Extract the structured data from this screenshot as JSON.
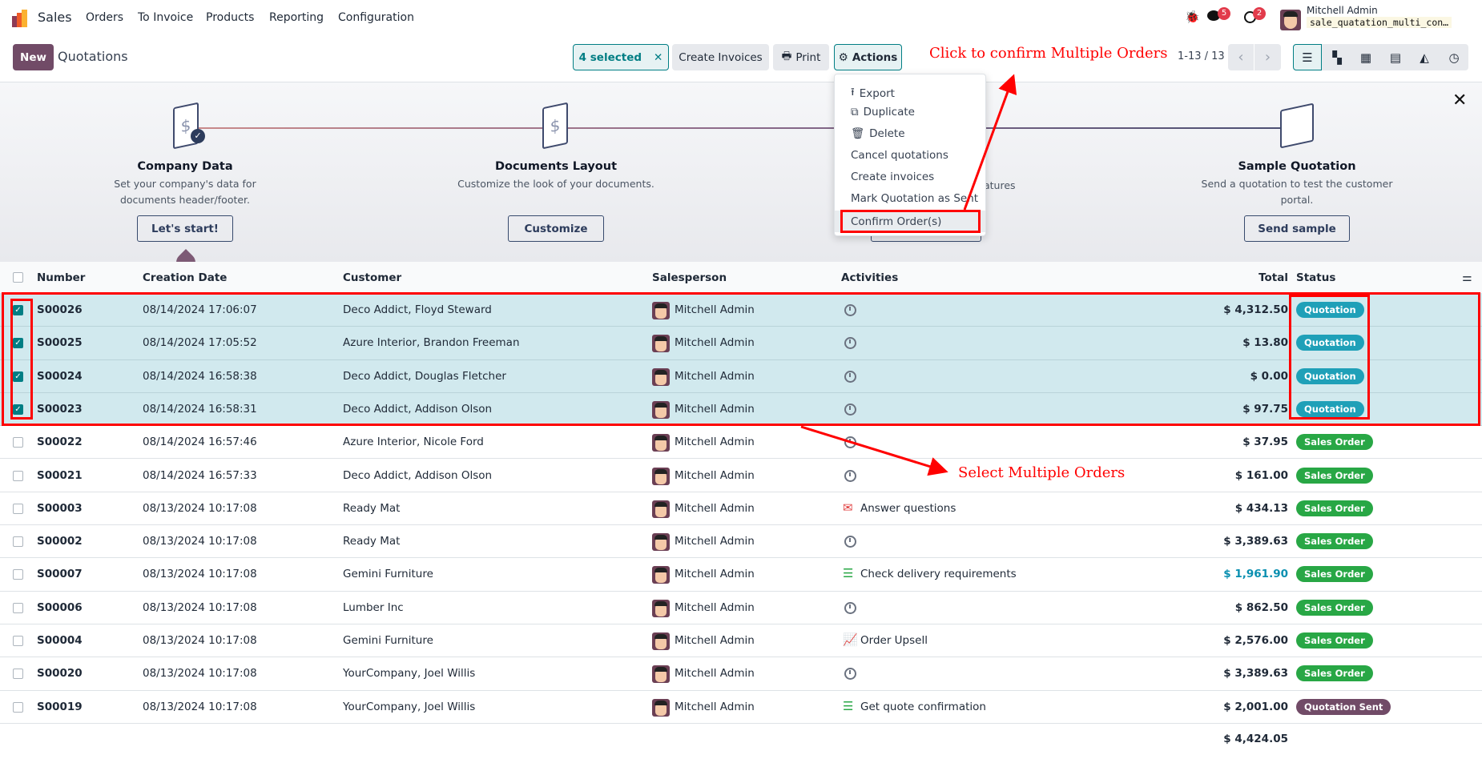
{
  "nav": {
    "app": "Sales",
    "menu": [
      "Orders",
      "To Invoice",
      "Products",
      "Reporting",
      "Configuration"
    ],
    "messages_count": "5",
    "activities_count": "2",
    "user": "Mitchell Admin",
    "database": "sale_quatation_multi_con…"
  },
  "control": {
    "new_label": "New",
    "title": "Quotations",
    "selected_label": "4 selected",
    "create_invoices": "Create Invoices",
    "print": "Print",
    "actions": "Actions",
    "pager": "1-13 / 13",
    "views": [
      "list",
      "kanban",
      "calendar",
      "pivot",
      "graph",
      "activity"
    ]
  },
  "onboarding": {
    "steps": [
      {
        "title": "Company Data",
        "desc": "Set your company's data for documents header/footer.",
        "button": "Let's start!"
      },
      {
        "title": "Documents Layout",
        "desc": "Customize the look of your documents.",
        "button": "Customize"
      },
      {
        "desc_fragment": "atures"
      },
      {
        "title": "Sample Quotation",
        "desc": "Send a quotation to test the customer portal.",
        "button": "Send sample"
      }
    ]
  },
  "actions_menu": [
    "Export",
    "Duplicate",
    "Delete",
    "Cancel quotations",
    "Create invoices",
    "Mark Quotation as Sent",
    "Confirm Order(s)"
  ],
  "table": {
    "headers": {
      "number": "Number",
      "date": "Creation Date",
      "customer": "Customer",
      "salesperson": "Salesperson",
      "activities": "Activities",
      "total": "Total",
      "status": "Status"
    },
    "rows": [
      {
        "selected": true,
        "number": "S00026",
        "date": "08/14/2024 17:06:07",
        "customer": "Deco Addict, Floyd Steward",
        "salesperson": "Mitchell Admin",
        "activity": "",
        "activity_icon": "clock",
        "total": "$ 4,312.50",
        "status": "Quotation"
      },
      {
        "selected": true,
        "number": "S00025",
        "date": "08/14/2024 17:05:52",
        "customer": "Azure Interior, Brandon Freeman",
        "salesperson": "Mitchell Admin",
        "activity": "",
        "activity_icon": "clock",
        "total": "$ 13.80",
        "status": "Quotation"
      },
      {
        "selected": true,
        "number": "S00024",
        "date": "08/14/2024 16:58:38",
        "customer": "Deco Addict, Douglas Fletcher",
        "salesperson": "Mitchell Admin",
        "activity": "",
        "activity_icon": "clock",
        "total": "$ 0.00",
        "status": "Quotation"
      },
      {
        "selected": true,
        "number": "S00023",
        "date": "08/14/2024 16:58:31",
        "customer": "Deco Addict, Addison Olson",
        "salesperson": "Mitchell Admin",
        "activity": "",
        "activity_icon": "clock",
        "total": "$ 97.75",
        "status": "Quotation"
      },
      {
        "selected": false,
        "number": "S00022",
        "date": "08/14/2024 16:57:46",
        "customer": "Azure Interior, Nicole Ford",
        "salesperson": "Mitchell Admin",
        "activity": "",
        "activity_icon": "clock",
        "total": "$ 37.95",
        "status": "Sales Order"
      },
      {
        "selected": false,
        "number": "S00021",
        "date": "08/14/2024 16:57:33",
        "customer": "Deco Addict, Addison Olson",
        "salesperson": "Mitchell Admin",
        "activity": "",
        "activity_icon": "clock",
        "total": "$ 161.00",
        "status": "Sales Order"
      },
      {
        "selected": false,
        "number": "S00003",
        "date": "08/13/2024 10:17:08",
        "customer": "Ready Mat",
        "salesperson": "Mitchell Admin",
        "activity": "Answer questions",
        "activity_icon": "envelope",
        "total": "$ 434.13",
        "status": "Sales Order"
      },
      {
        "selected": false,
        "number": "S00002",
        "date": "08/13/2024 10:17:08",
        "customer": "Ready Mat",
        "salesperson": "Mitchell Admin",
        "activity": "",
        "activity_icon": "clock",
        "total": "$ 3,389.63",
        "status": "Sales Order"
      },
      {
        "selected": false,
        "number": "S00007",
        "date": "08/13/2024 10:17:08",
        "customer": "Gemini Furniture",
        "salesperson": "Mitchell Admin",
        "activity": "Check delivery requirements",
        "activity_icon": "list",
        "total": "$ 1,961.90",
        "total_highlight": true,
        "status": "Sales Order"
      },
      {
        "selected": false,
        "number": "S00006",
        "date": "08/13/2024 10:17:08",
        "customer": "Lumber Inc",
        "salesperson": "Mitchell Admin",
        "activity": "",
        "activity_icon": "clock",
        "total": "$ 862.50",
        "status": "Sales Order"
      },
      {
        "selected": false,
        "number": "S00004",
        "date": "08/13/2024 10:17:08",
        "customer": "Gemini Furniture",
        "salesperson": "Mitchell Admin",
        "activity": "Order Upsell",
        "activity_icon": "chart",
        "total": "$ 2,576.00",
        "status": "Sales Order"
      },
      {
        "selected": false,
        "number": "S00020",
        "date": "08/13/2024 10:17:08",
        "customer": "YourCompany, Joel Willis",
        "salesperson": "Mitchell Admin",
        "activity": "",
        "activity_icon": "clock",
        "total": "$ 3,389.63",
        "status": "Sales Order"
      },
      {
        "selected": false,
        "number": "S00019",
        "date": "08/13/2024 10:17:08",
        "customer": "YourCompany, Joel Willis",
        "salesperson": "Mitchell Admin",
        "activity": "Get quote confirmation",
        "activity_icon": "list",
        "total": "$ 2,001.00",
        "status": "Quotation Sent"
      }
    ],
    "sum_total": "$ 4,424.05"
  },
  "annotations": {
    "confirm": "Click to confirm Multiple Orders",
    "select": "Select Multiple Orders"
  },
  "colors": {
    "brand": "#714b67",
    "accent": "#017e84",
    "selected_row": "#d1e9ee",
    "quotation": "#1fa0b8",
    "sales_order": "#28a745",
    "quotation_sent": "#714b67",
    "annotation": "#ff0000"
  }
}
